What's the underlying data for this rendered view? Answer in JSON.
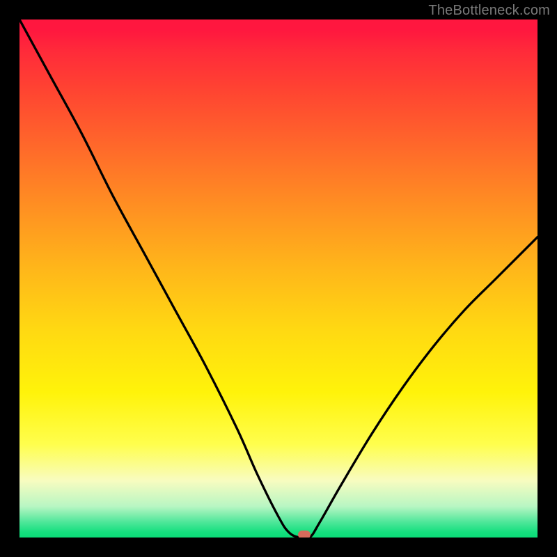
{
  "watermark": {
    "text": "TheBottleneck.com"
  },
  "chart_data": {
    "type": "line",
    "title": "",
    "xlabel": "",
    "ylabel": "",
    "xlim": [
      0,
      100
    ],
    "ylim": [
      0,
      100
    ],
    "grid": false,
    "legend": false,
    "background": "vertical rainbow gradient (red top → green bottom)",
    "series": [
      {
        "name": "bottleneck-curve",
        "x": [
          0,
          6,
          12,
          18,
          24,
          30,
          36,
          42,
          46,
          50,
          52,
          54,
          56,
          58,
          62,
          68,
          74,
          80,
          86,
          92,
          100
        ],
        "values": [
          100,
          89,
          78,
          66,
          55,
          44,
          33,
          21,
          12,
          4,
          1,
          0,
          0,
          3,
          10,
          20,
          29,
          37,
          44,
          50,
          58
        ]
      }
    ],
    "marker": {
      "x": 55,
      "y": 0.5,
      "shape": "rounded-rect",
      "color": "#d66a5b"
    },
    "frame_color": "#000000",
    "frame_thickness_px": 28
  },
  "colors": {
    "gradient_top": "#ff173f",
    "gradient_bottom": "#0bdc78",
    "curve": "#000000",
    "marker": "#d66a5b",
    "watermark": "#7a7a7a"
  }
}
